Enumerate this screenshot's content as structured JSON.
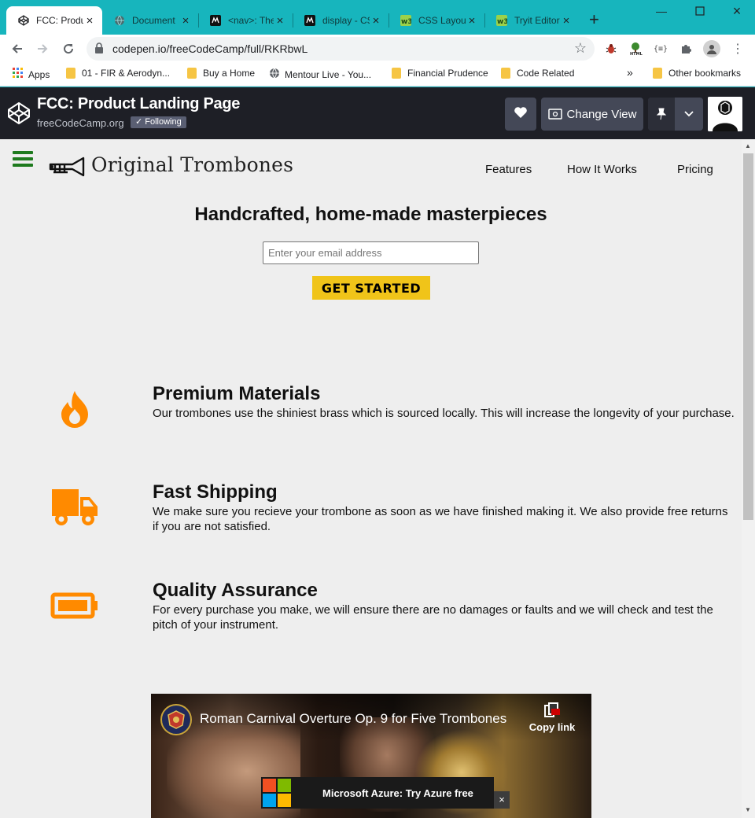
{
  "browser": {
    "tabs": [
      {
        "title": "FCC: Product Landing Page",
        "active": true,
        "icon": "codepen-icon"
      },
      {
        "title": "Document",
        "active": false,
        "icon": "globe-icon"
      },
      {
        "title": "<nav>: The Navigation Section element",
        "active": false,
        "icon": "mdn-icon"
      },
      {
        "title": "display - CSS",
        "active": false,
        "icon": "mdn-icon"
      },
      {
        "title": "CSS Layout",
        "active": false,
        "icon": "w3schools-icon"
      },
      {
        "title": "Tryit Editor",
        "active": false,
        "icon": "w3schools-icon"
      }
    ],
    "url": "codepen.io/freeCodeCamp/full/RKRbwL",
    "bookmarks": [
      {
        "label": "Apps",
        "icon": "apps-grid-icon"
      },
      {
        "label": "01 - FIR & Aerodyn...",
        "icon": "folder-icon"
      },
      {
        "label": "Buy a Home",
        "icon": "folder-icon"
      },
      {
        "label": "Mentour Live - You...",
        "icon": "globe-icon"
      },
      {
        "label": "Financial Prudence",
        "icon": "folder-icon"
      },
      {
        "label": "Code Related",
        "icon": "folder-icon"
      },
      {
        "label": "»",
        "icon": "overflow-icon"
      },
      {
        "label": "Other bookmarks",
        "icon": "folder-icon"
      }
    ]
  },
  "codepen": {
    "title": "FCC: Product Landing Page",
    "owner": "freeCodeCamp.org",
    "following": "✓ Following",
    "change_view": "Change View"
  },
  "site": {
    "brand": "Original Trombones",
    "nav": [
      "Features",
      "How It Works",
      "Pricing"
    ],
    "hero_title": "Handcrafted, home-made masterpieces",
    "email_placeholder": "Enter your email address",
    "cta": "GET STARTED",
    "features": [
      {
        "title": "Premium Materials",
        "desc": "Our trombones use the shiniest brass which is sourced locally. This will increase the longevity of your purchase.",
        "icon": "fire-icon"
      },
      {
        "title": "Fast Shipping",
        "desc": "We make sure you recieve your trombone as soon as we have finished making it. We also provide free returns if you are not satisfied.",
        "icon": "truck-icon"
      },
      {
        "title": "Quality Assurance",
        "desc": "For every purchase you make, we will ensure there are no damages or faults and we will check and test the pitch of your instrument.",
        "icon": "battery-icon"
      }
    ],
    "video": {
      "title": "Roman Carnival Overture Op. 9 for Five Trombones",
      "copy_link": "Copy link",
      "ad_text": "Microsoft Azure: Try Azure free",
      "ad_close": "×"
    }
  },
  "colors": {
    "chrome_frame": "#17b5bd",
    "codepen_header": "#1e1f26",
    "page_bg": "#eeeeee",
    "accent_orange": "#ff8a00",
    "cta_yellow": "#f0c419",
    "hamburger_green": "#1e7a1e"
  }
}
